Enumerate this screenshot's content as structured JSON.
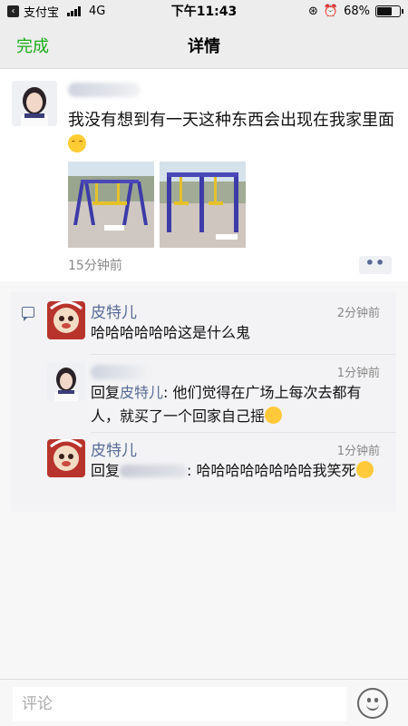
{
  "status_bar": {
    "back_app": "支付宝",
    "network": "4G",
    "time": "下午11:43",
    "battery": "68%",
    "battery_level": 0.68
  },
  "nav": {
    "done": "完成",
    "title": "详情"
  },
  "post": {
    "text": "我没有想到有一天这种东西会出现在我家里面",
    "time": "15分钟前",
    "more": "••"
  },
  "comments": [
    {
      "name": "皮特儿",
      "time": "2分钟前",
      "text": "哈哈哈哈哈哈这是什么鬼"
    },
    {
      "time": "1分钟前",
      "reply_prefix": "回复",
      "reply_to": "皮特儿",
      "text": ": 他们觉得在广场上每次去都有人，就买了一个回家自己摇"
    },
    {
      "name": "皮特儿",
      "time": "1分钟前",
      "reply_prefix": "回复",
      "text": ": 哈哈哈哈哈哈哈哈我笑死"
    }
  ],
  "input": {
    "placeholder": "评论"
  },
  "colors": {
    "accent_green": "#1aad19",
    "link_blue": "#576b95"
  }
}
